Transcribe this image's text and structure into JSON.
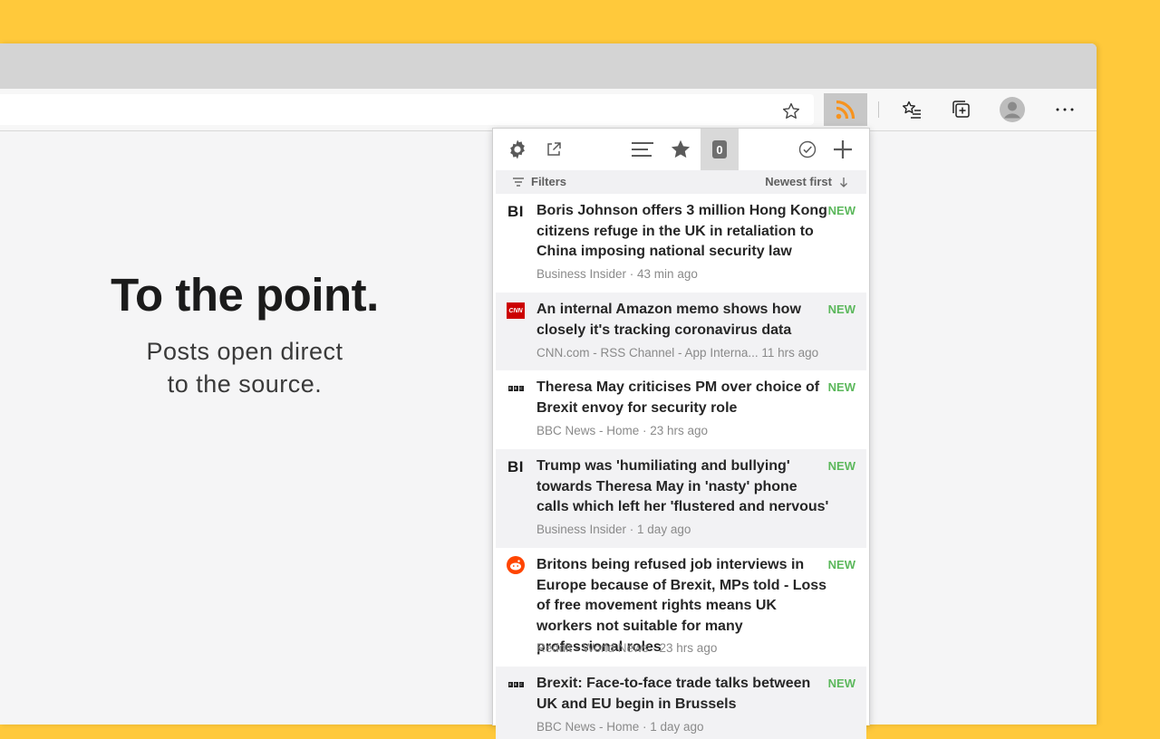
{
  "promo": {
    "headline": "To the point.",
    "subline_1": "Posts open direct",
    "subline_2": "to the source."
  },
  "popup": {
    "count": "0",
    "filters_label": "Filters",
    "sort_label": "Newest first",
    "items": [
      {
        "source_icon": "business-insider",
        "icon_text": "BI",
        "title": "Boris Johnson offers 3 million Hong Kong citizens refuge in the UK in retaliation to China imposing national security law",
        "badge": "NEW",
        "meta": "Business Insider · 43 min ago"
      },
      {
        "source_icon": "cnn",
        "icon_text": "CNN",
        "title": "An internal Amazon memo shows how closely it's tracking coronavirus data",
        "badge": "NEW",
        "meta": "CNN.com - RSS Channel - App Interna... 11 hrs ago"
      },
      {
        "source_icon": "bbc",
        "icon_text": "BBC",
        "title": "Theresa May criticises PM over choice of Brexit envoy for security role",
        "badge": "NEW",
        "meta": "BBC News - Home · 23 hrs ago"
      },
      {
        "source_icon": "business-insider",
        "icon_text": "BI",
        "title": "Trump was 'humiliating and bullying' towards Theresa May in 'nasty' phone calls which left her 'flustered and nervous'",
        "badge": "NEW",
        "meta": "Business Insider · 1 day ago"
      },
      {
        "source_icon": "reddit",
        "icon_text": "",
        "title": "Britons being refused job interviews in Europe because of Brexit, MPs told - Loss of free movement rights means UK workers not suitable for many professional roles",
        "badge": "NEW",
        "meta": "Reddit - World News · 23 hrs ago"
      },
      {
        "source_icon": "bbc",
        "icon_text": "BBC",
        "title": "Brexit: Face-to-face trade talks between UK and EU begin in Brussels",
        "badge": "NEW",
        "meta": "BBC News - Home · 1 day ago"
      }
    ]
  },
  "colors": {
    "background": "#ffc93b",
    "new_badge": "#5cb85c",
    "rss_orange": "#f7931e"
  }
}
